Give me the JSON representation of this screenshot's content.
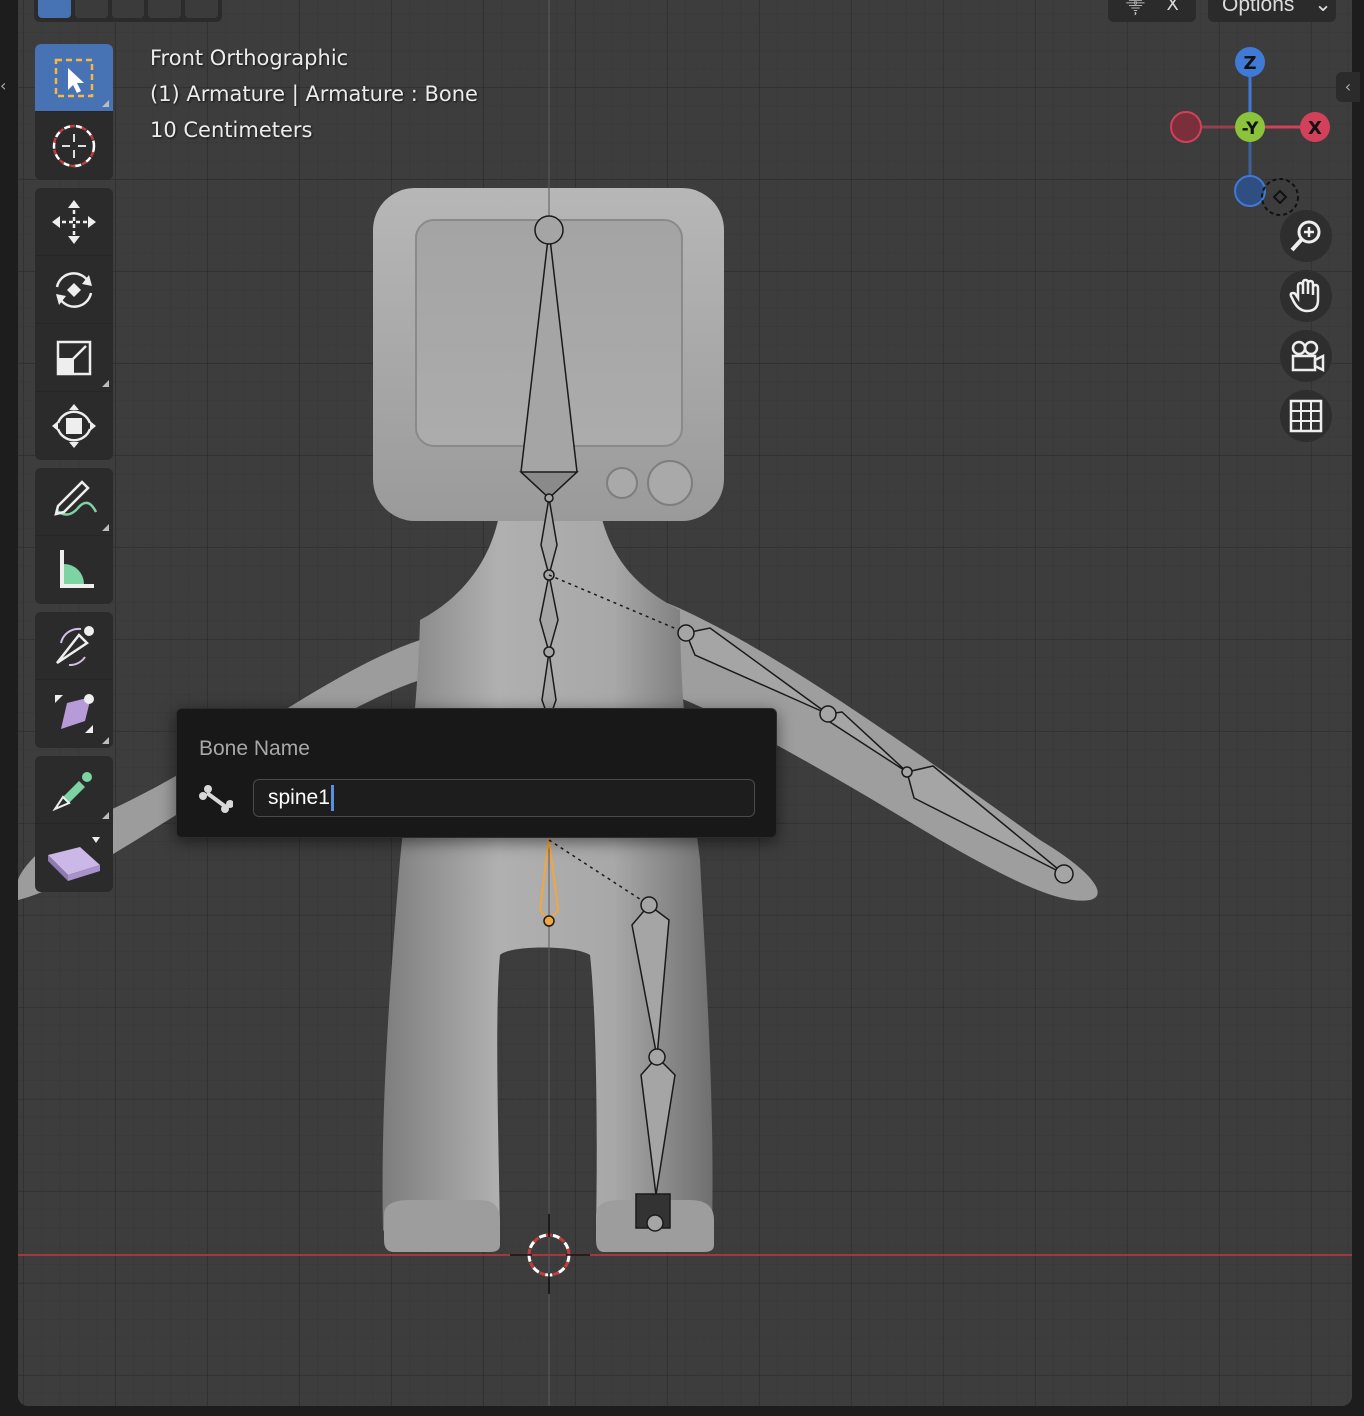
{
  "viewport": {
    "view_name": "Front Orthographic",
    "object_info": "(1) Armature | Armature : Bone",
    "scale_text": "10 Centimeters"
  },
  "header": {
    "options_label": "Options",
    "pin_label": "X"
  },
  "toolbar": {
    "tools": [
      {
        "name": "select-box-tool",
        "icon": "select-box-icon",
        "active": true
      },
      {
        "name": "cursor-tool",
        "icon": "cursor-icon"
      },
      {
        "name": "move-tool",
        "icon": "move-icon"
      },
      {
        "name": "rotate-tool",
        "icon": "rotate-icon"
      },
      {
        "name": "scale-tool",
        "icon": "scale-icon"
      },
      {
        "name": "transform-tool",
        "icon": "transform-icon"
      },
      {
        "name": "annotate-tool",
        "icon": "annotate-icon"
      },
      {
        "name": "measure-tool",
        "icon": "measure-icon"
      },
      {
        "name": "roll-tool",
        "icon": "roll-icon"
      },
      {
        "name": "bone-size-tool",
        "icon": "bone-size-icon"
      },
      {
        "name": "extrude-tool",
        "icon": "extrude-icon"
      },
      {
        "name": "shear-tool",
        "icon": "shear-icon"
      }
    ]
  },
  "gizmo": {
    "axis_z": "Z",
    "axis_neg_y": "-Y",
    "axis_x": "X",
    "colors": {
      "x": "#d1415a",
      "y": "#8bc43a",
      "z": "#3e7ad6"
    }
  },
  "rename_popup": {
    "title": "Bone Name",
    "value": "spine1",
    "icon": "bone-icon"
  },
  "colors": {
    "active_tool": "#4772b3",
    "selected_bone": "#f3a63d",
    "axis_line": "#c1393f"
  }
}
